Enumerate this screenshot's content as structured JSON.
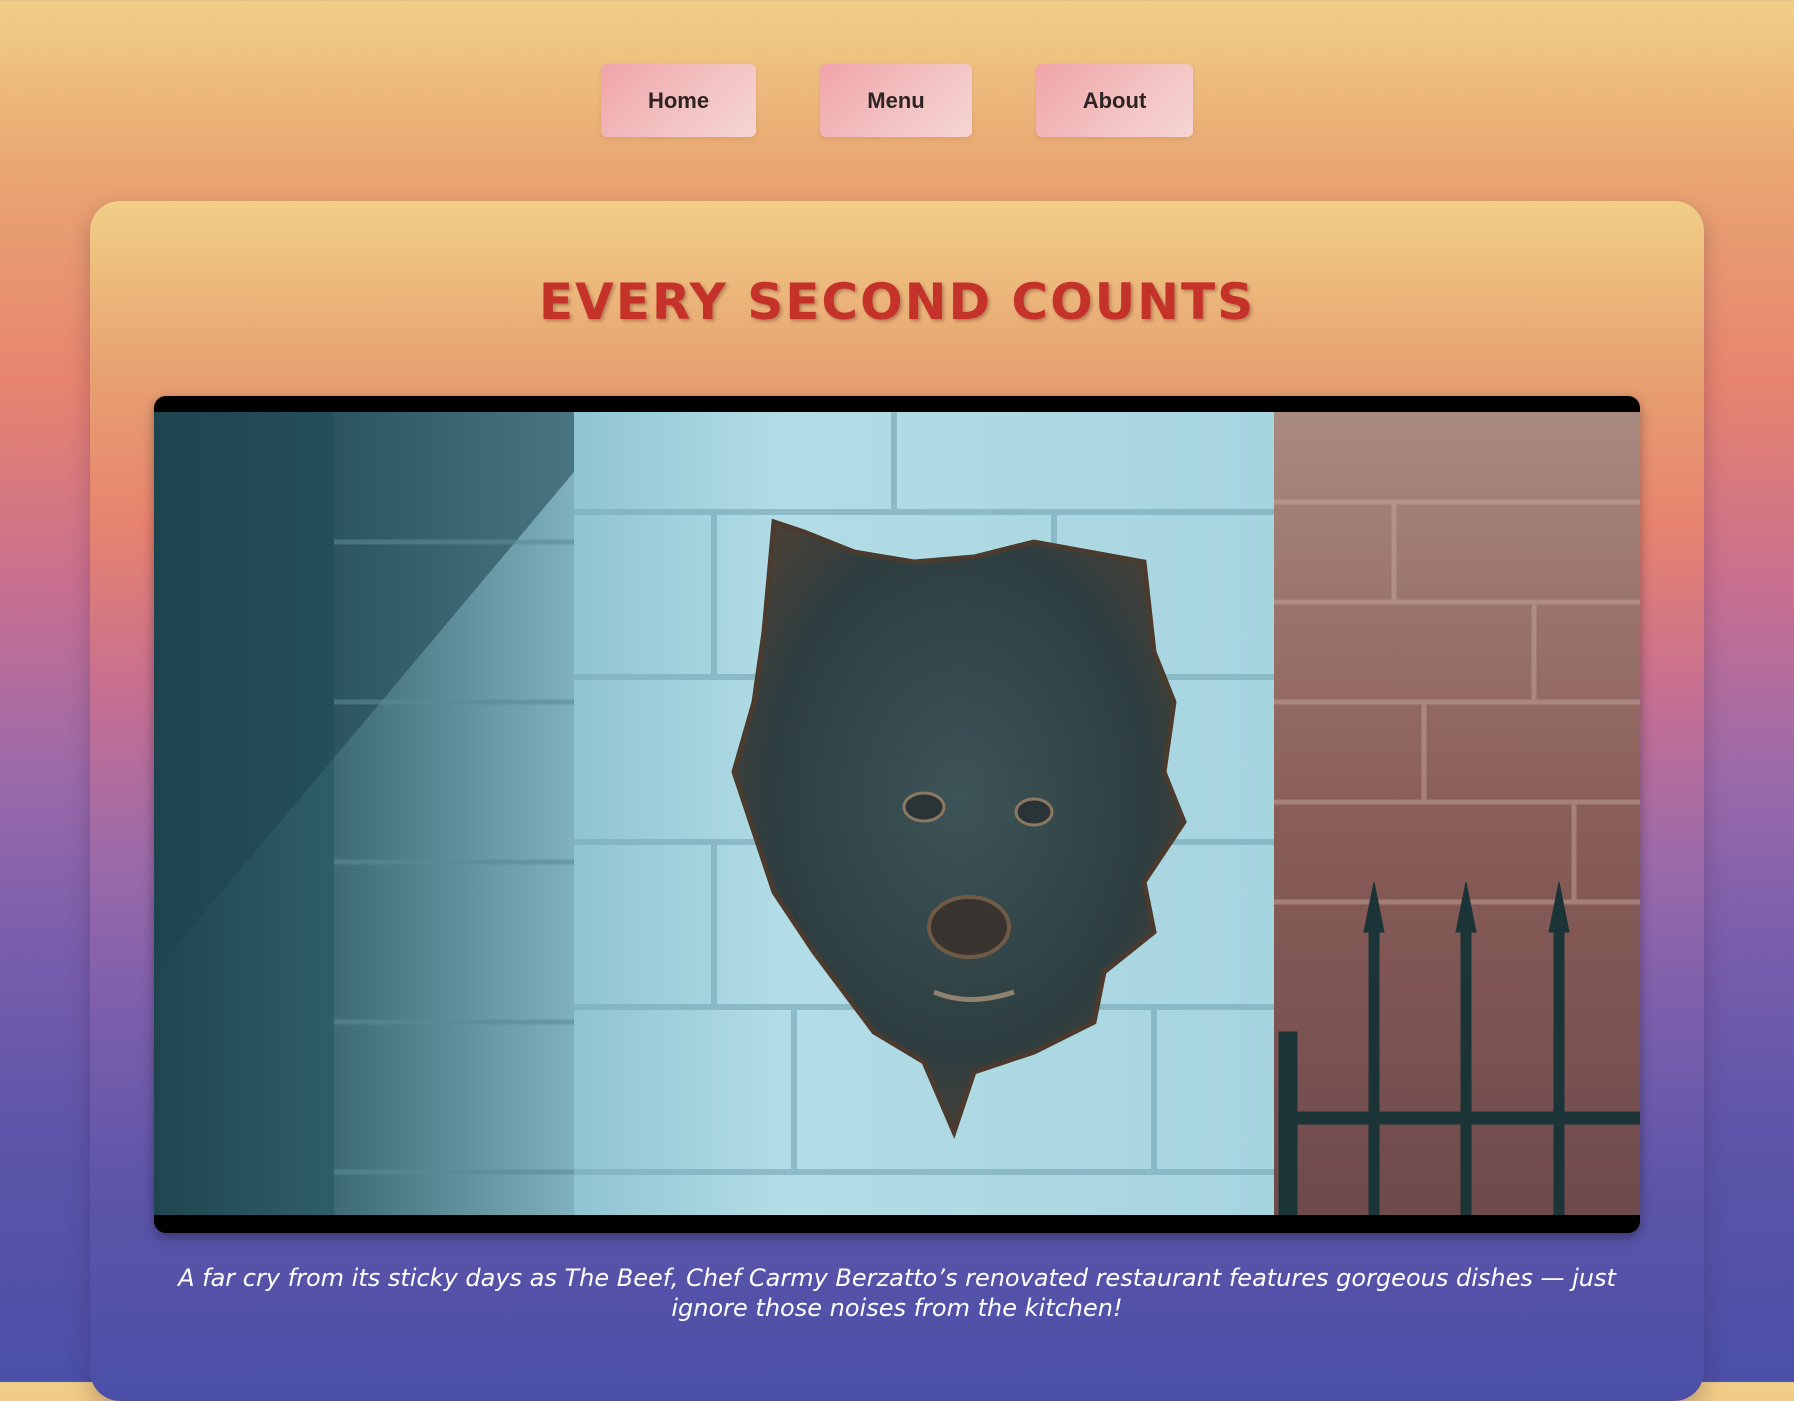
{
  "nav": {
    "items": [
      {
        "label": "Home"
      },
      {
        "label": "Menu"
      },
      {
        "label": "About"
      }
    ]
  },
  "hero": {
    "title": "EVERY SECOND COUNTS",
    "caption": "A far cry from its sticky days as The Beef, Chef Carmy Berzatto’s renovated restaurant features gorgeous dishes — just ignore those noises from the kitchen!"
  },
  "image": {
    "subject": "bear-head-wall-plaque-icon"
  },
  "colors": {
    "title": "#c4322a",
    "button_bg": "#f3c4c4",
    "button_text": "#2e2424",
    "caption": "#ffffff"
  }
}
